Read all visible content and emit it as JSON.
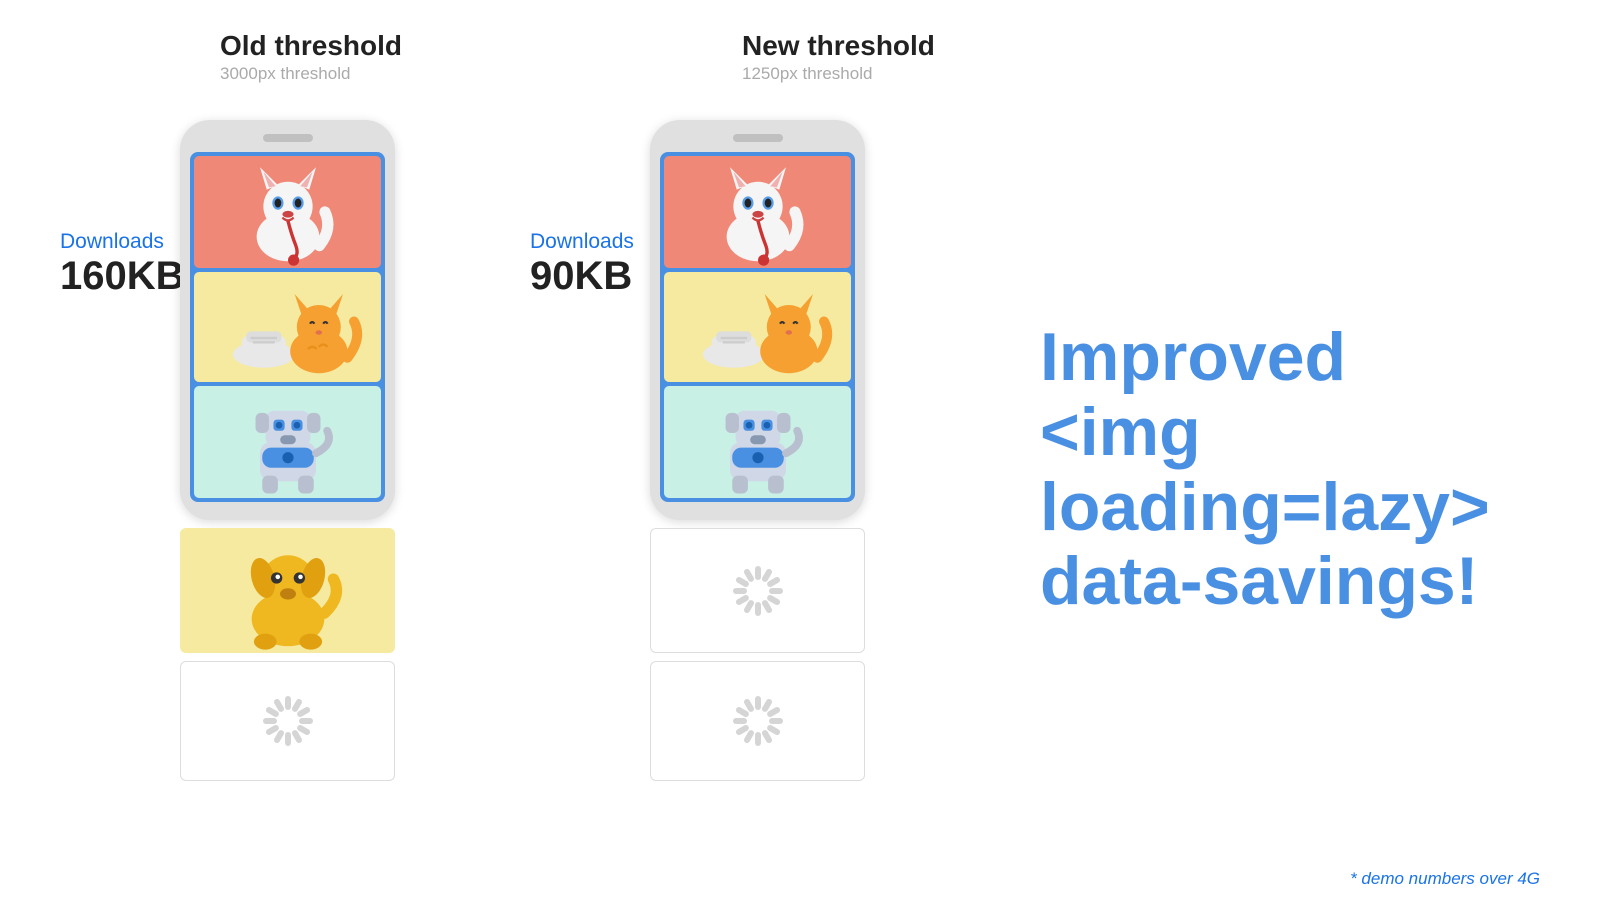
{
  "header": {
    "old_threshold_title": "Old threshold",
    "old_threshold_sub": "3000px threshold",
    "new_threshold_title": "New threshold",
    "new_threshold_sub": "1250px threshold"
  },
  "old": {
    "downloads_label": "Downloads",
    "downloads_size": "160KB"
  },
  "new": {
    "downloads_label": "Downloads",
    "downloads_size": "90KB"
  },
  "tagline_line1": "Improved",
  "tagline_line2": "<img loading=lazy>",
  "tagline_line3": "data-savings!",
  "demo_note": "* demo numbers over 4G",
  "colors": {
    "accent_blue": "#4a90e2",
    "text_dark": "#222222",
    "text_gray": "#999999",
    "sparkle_yellow": "#f0c020",
    "downloads_blue": "#1a73e8"
  }
}
